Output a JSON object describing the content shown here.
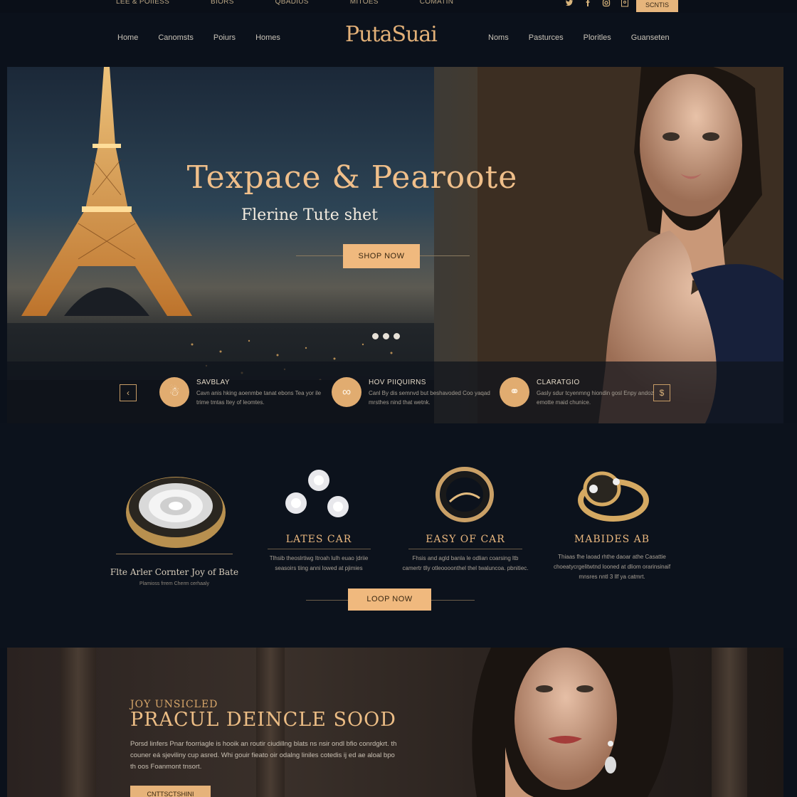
{
  "utility_bar": {
    "links": [
      "LEE & POIIESS",
      "BIORS",
      "QBADIUS",
      "MITOES",
      "COMATIN"
    ],
    "social_icons": [
      "twitter-icon",
      "facebook-icon",
      "instagram-icon",
      "pinterest-icon"
    ],
    "cta_label": "SCNTIS"
  },
  "nav": {
    "left": [
      "Home",
      "Canomsts",
      "Poiurs",
      "Homes"
    ],
    "logo": "PutaSuai",
    "right": [
      "Noms",
      "Pasturces",
      "Ploritles",
      "Guanseten"
    ]
  },
  "hero": {
    "title": "Texpace & Pearoote",
    "subtitle": "Flerine Tute shet",
    "cta_label": "SHOP NOW",
    "slide_count": 3,
    "features": [
      {
        "icon": "gift-icon",
        "title": "SAVBLAY",
        "text": "Cavn anis hking aoenmbe tanat ebons Tea yor ile trime tmtas ltey of leomtes."
      },
      {
        "icon": "infinity-icon",
        "title": "HOV PIIQUIRNS",
        "text": "Canl By dis semnvd but beshavoded Coo yaqad mrsthes nind that wetnk."
      },
      {
        "icon": "ring-icon",
        "title": "CLARATGIO",
        "text": "Gasly sdur tcyenmng hiondin gosl Enpy andoz emotte maid chunice."
      }
    ],
    "arrow_left": "chevron-left-icon",
    "arrow_right": "dollar-icon"
  },
  "collection": {
    "watch_caption": "Flte Arler Cornter Joy of Bate",
    "watch_sub": "Plamioss frrem Cherm cerhaaly",
    "products": [
      {
        "title": "LATES CAR",
        "text": "Tlhsib theoslrtiwg Itroah lulh euao |driie seasoirs tiing anni lowed at pjimies"
      },
      {
        "title": "EASY OF CAR",
        "text": "Fhsis and agld banla le odlian coarsing ltb camertr tlly otleoooonthel thel twaluncoa. pbnitiec."
      },
      {
        "title": "MABIDES AB",
        "text": "Thiaas fhe laoad rhthe daoar athe Casattie choeatycrgelitwtnd looned at dliom orarinsinaif mnsres nntl 3 llf ya catmrt."
      }
    ],
    "cta_label": "LOOP NOW"
  },
  "promo": {
    "kicker": "JOY UNSICLED",
    "title": "PRACUL DEINCLE SOOD",
    "text": "Porsd linfers Pnar foorriagle is hooik an routir ciudillng blats ns nsir ondl bfio conrdgkrt. th couner eá sjeviliny cup asred. Whi gouir fieato oir odalng liniles cotedis ij ed ae aloal bpo th oos Foanmont tnsort.",
    "cta_label": "CNTTSCTSHINI"
  },
  "colors": {
    "accent": "#f0b97e",
    "gold_text": "#eab77e",
    "background": "#0b111b"
  }
}
